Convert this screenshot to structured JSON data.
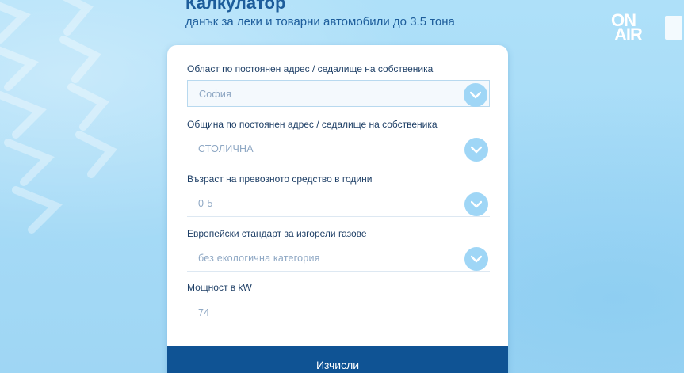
{
  "header": {
    "title": "Калкулатор",
    "subtitle": "данък за леки и товарни автомобили до 3.5 тона"
  },
  "logo": {
    "line1": "ON",
    "line2": "AIR"
  },
  "form": {
    "fields": [
      {
        "label": "Област по постоянен адрес / седалище на собственика",
        "value": "София"
      },
      {
        "label": "Община по постоянен адрес / седалище на собственика",
        "value": "СТОЛИЧНА"
      },
      {
        "label": "Възраст на превозното средство в години",
        "value": "0-5"
      },
      {
        "label": "Европейски стандарт за изгорели газове",
        "value": "без екологична категория"
      }
    ],
    "power": {
      "label": "Мощност в kW",
      "value": "74"
    },
    "submit_label": "Изчисли"
  },
  "colors": {
    "background": "#a8dcf7",
    "accent": "#1d5d9b",
    "button": "#0f5394",
    "chevron": "#9fd6f6"
  },
  "icons": {
    "dropdown": "chevron-down-icon"
  }
}
